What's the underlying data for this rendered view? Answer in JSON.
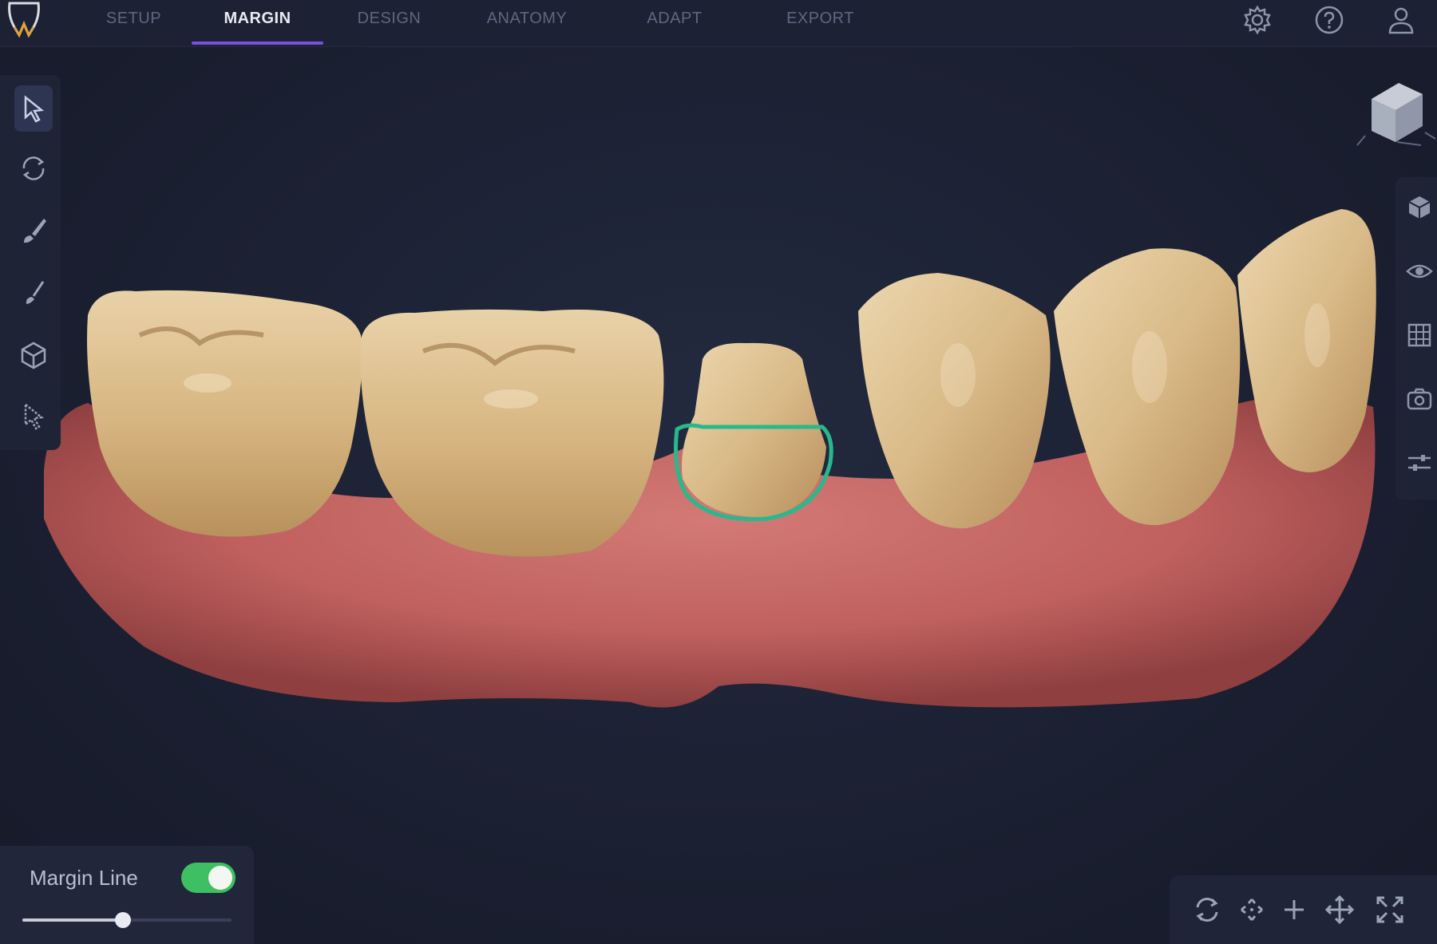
{
  "nav": {
    "tabs": [
      {
        "label": "SETUP",
        "active": false
      },
      {
        "label": "MARGIN",
        "active": true
      },
      {
        "label": "DESIGN",
        "active": false
      },
      {
        "label": "ANATOMY",
        "active": false
      },
      {
        "label": "ADAPT",
        "active": false
      },
      {
        "label": "EXPORT",
        "active": false
      }
    ],
    "icons": [
      "gear-icon",
      "help-icon",
      "user-icon"
    ]
  },
  "left_toolbar": {
    "tools": [
      "select-arrow-icon",
      "rotate-icon",
      "brush-icon",
      "brush-small-icon",
      "cube-icon",
      "pointer-select-icon"
    ],
    "active_tool": "select-arrow-icon"
  },
  "right_toolbar": {
    "tools": [
      "solid-view-icon",
      "eye-icon",
      "grid-icon",
      "camera-icon",
      "sliders-icon"
    ]
  },
  "margin_panel": {
    "label": "Margin Line",
    "toggle_on": true,
    "slider_value": 0.48
  },
  "view_controls": [
    "reset-rotation-icon",
    "pan-center-icon",
    "add-point-icon",
    "move-icon",
    "fit-screen-icon"
  ],
  "colors": {
    "accent": "#7b4fe0",
    "toggle_on": "#3fbf63",
    "margin_line": "#27b98c",
    "background": "#1b2032"
  }
}
